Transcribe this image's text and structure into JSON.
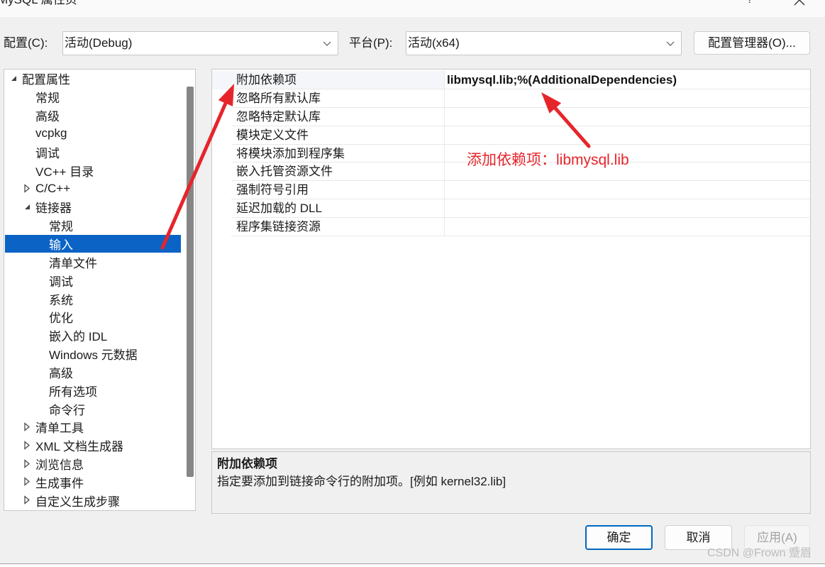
{
  "window": {
    "title": "MySQL 属性页",
    "help_label": "?"
  },
  "toolbar": {
    "config_label": "配置(C):",
    "config_value": "活动(Debug)",
    "platform_label": "平台(P):",
    "platform_value": "活动(x64)",
    "config_manager_label": "配置管理器(O)..."
  },
  "tree": [
    {
      "label": "配置属性",
      "expanded": true,
      "children": [
        {
          "label": "常规"
        },
        {
          "label": "高级"
        },
        {
          "label": "vcpkg"
        },
        {
          "label": "调试"
        },
        {
          "label": "VC++ 目录"
        },
        {
          "label": "C/C++",
          "expanded": false
        },
        {
          "label": "链接器",
          "expanded": true,
          "children": [
            {
              "label": "常规"
            },
            {
              "label": "输入",
              "selected": true
            },
            {
              "label": "清单文件"
            },
            {
              "label": "调试"
            },
            {
              "label": "系统"
            },
            {
              "label": "优化"
            },
            {
              "label": "嵌入的 IDL"
            },
            {
              "label": "Windows 元数据"
            },
            {
              "label": "高级"
            },
            {
              "label": "所有选项"
            },
            {
              "label": "命令行"
            }
          ]
        },
        {
          "label": "清单工具",
          "expanded": false
        },
        {
          "label": "XML 文档生成器",
          "expanded": false
        },
        {
          "label": "浏览信息",
          "expanded": false
        },
        {
          "label": "生成事件",
          "expanded": false
        },
        {
          "label": "自定义生成步骤",
          "expanded": false
        }
      ]
    }
  ],
  "property_grid": {
    "rows": [
      {
        "name": "附加依赖项",
        "value": "libmysql.lib;%(AdditionalDependencies)"
      },
      {
        "name": "忽略所有默认库",
        "value": ""
      },
      {
        "name": "忽略特定默认库",
        "value": ""
      },
      {
        "name": "模块定义文件",
        "value": ""
      },
      {
        "name": "将模块添加到程序集",
        "value": ""
      },
      {
        "name": "嵌入托管资源文件",
        "value": ""
      },
      {
        "name": "强制符号引用",
        "value": ""
      },
      {
        "name": "延迟加载的 DLL",
        "value": ""
      },
      {
        "name": "程序集链接资源",
        "value": ""
      }
    ]
  },
  "description": {
    "title": "附加依赖项",
    "text": "指定要添加到链接命令行的附加项。[例如 kernel32.lib]"
  },
  "buttons": {
    "ok_label": "确定",
    "cancel_label": "取消",
    "apply_label": "应用(A)",
    "apply_enabled": false
  },
  "annotation": {
    "text": "添加依赖项：libmysql.lib"
  },
  "watermark": "CSDN @Frown 蹙眉",
  "icons": {
    "close": "close-icon",
    "dropdown": "chevron-down-icon",
    "tree_expanded": "expanded-arrow-icon",
    "tree_collapsed": "collapsed-arrow-icon",
    "annotation_arrow": "annotation-arrow-icon"
  },
  "colors": {
    "selection": "#0b63c5",
    "annotation_red": "#e6252b",
    "default_button_border": "#0067c0",
    "dialog_background": "#f0f0f0"
  }
}
